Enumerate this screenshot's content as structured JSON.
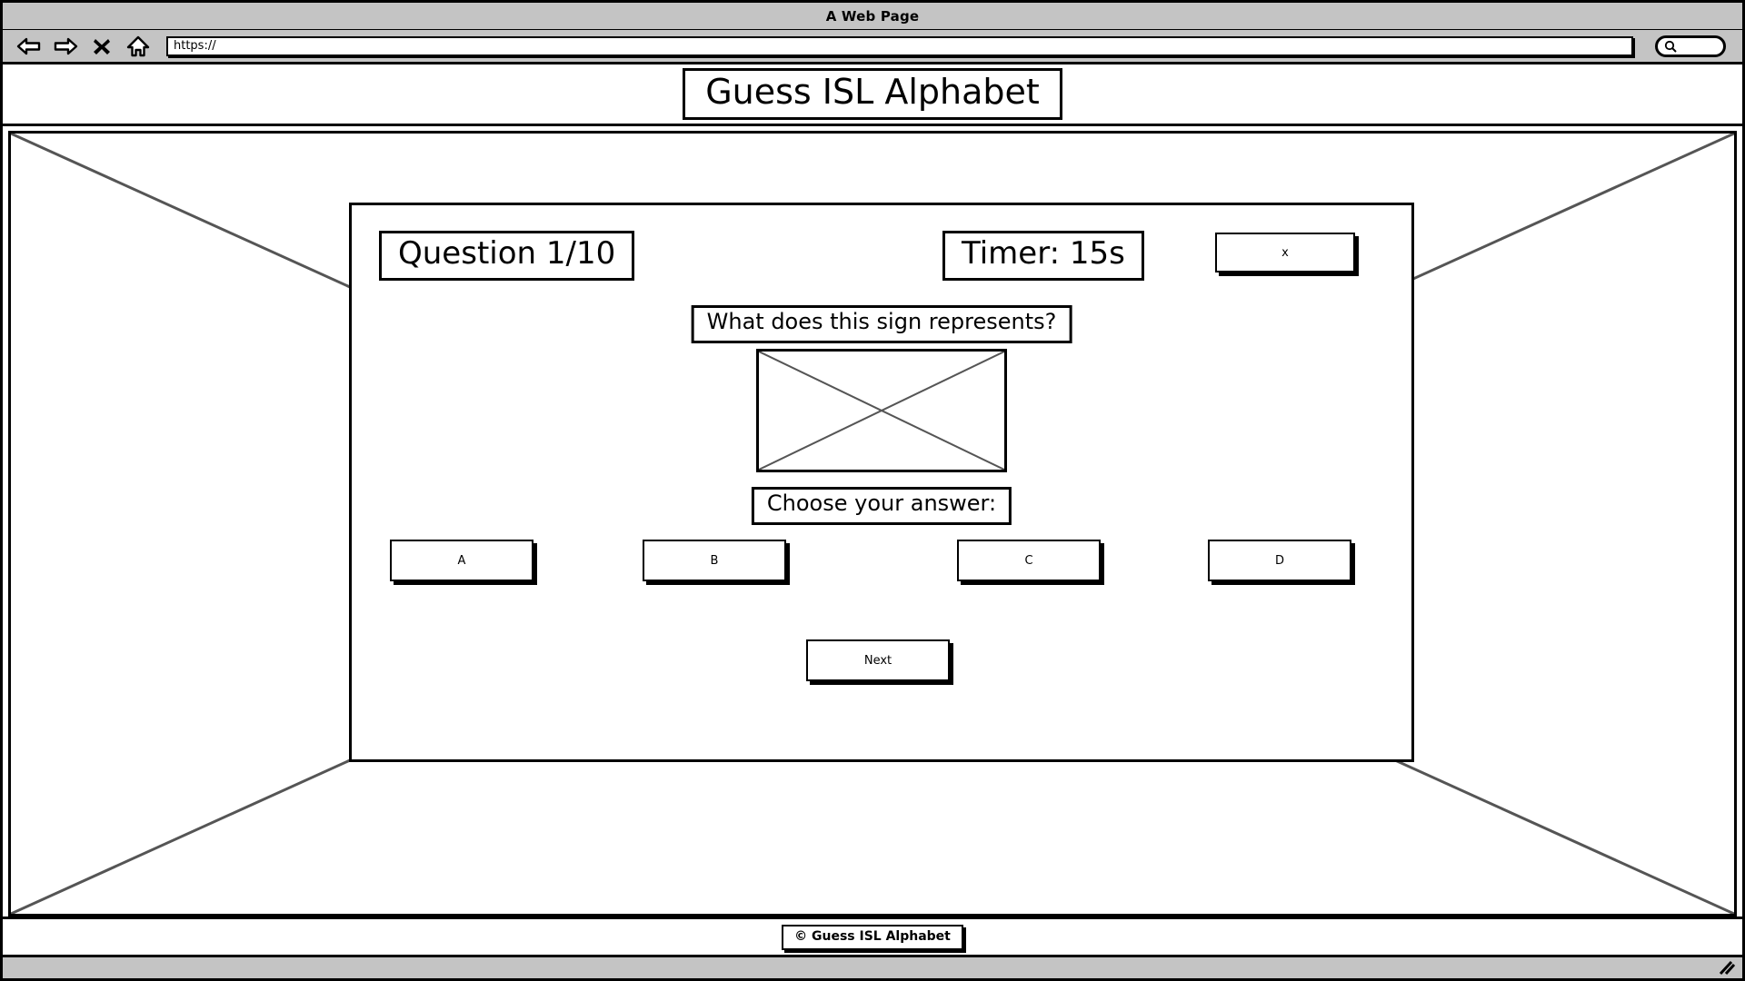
{
  "browser": {
    "window_title": "A Web Page",
    "nav": [
      {
        "name": "back-icon",
        "label": "Back"
      },
      {
        "name": "forward-icon",
        "label": "Forward"
      },
      {
        "name": "stop-icon",
        "label": "x"
      },
      {
        "name": "home-icon",
        "label": "Home"
      }
    ],
    "url_value": "https://",
    "url_placeholder": "https://",
    "search_placeholder": "",
    "search_value": "",
    "search_icon": "search-icon",
    "resize_grip_icon": "resize-grip-icon"
  },
  "header": {
    "site_title": "Guess ISL Alphabet"
  },
  "quiz": {
    "question_counter": "Question 1/10",
    "timer": "Timer: 15s",
    "close_label": "x",
    "prompt": "What does this sign represents?",
    "sign_image_alt": "image-placeholder",
    "choose_label": "Choose your answer:",
    "answers": [
      {
        "id": "a",
        "label": "A"
      },
      {
        "id": "b",
        "label": "B"
      },
      {
        "id": "c",
        "label": "C"
      },
      {
        "id": "d",
        "label": "D"
      }
    ],
    "next_label": "Next"
  },
  "footer": {
    "copyright": "© Guess ISL Alphabet"
  },
  "colors": {
    "chrome": "#c4c4c4",
    "ink": "#000000",
    "paper": "#ffffff",
    "placeholder_stroke": "#555555"
  }
}
